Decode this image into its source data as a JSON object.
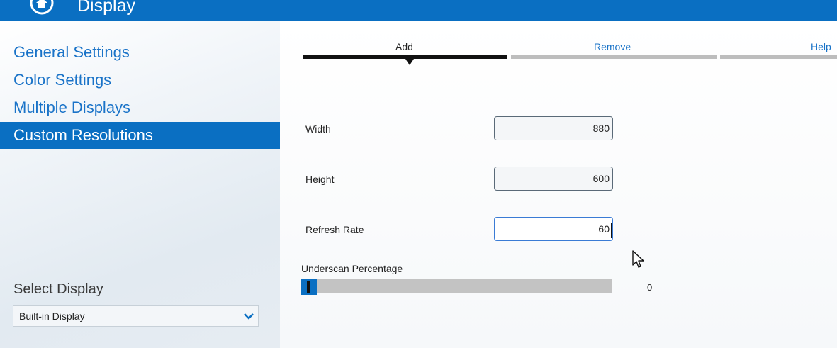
{
  "header": {
    "title": "Display",
    "icon": "home-icon"
  },
  "sidebar": {
    "items": [
      {
        "label": "General Settings",
        "selected": false
      },
      {
        "label": "Color Settings",
        "selected": false
      },
      {
        "label": "Multiple Displays",
        "selected": false
      },
      {
        "label": "Custom Resolutions",
        "selected": true
      }
    ],
    "select_display": {
      "label": "Select Display",
      "value": "Built-in Display",
      "icon": "chevron-down-icon"
    }
  },
  "tabs": [
    {
      "label": "Add",
      "active": true
    },
    {
      "label": "Remove",
      "active": false
    },
    {
      "label": "Help",
      "active": false
    }
  ],
  "form": {
    "width": {
      "label": "Width",
      "value": "880"
    },
    "height": {
      "label": "Height",
      "value": "600"
    },
    "refresh_rate": {
      "label": "Refresh Rate",
      "value": "60"
    }
  },
  "underscan": {
    "label": "Underscan Percentage",
    "value": "0",
    "level": 0
  },
  "colors": {
    "accent": "#0a6fc2",
    "link": "#1a73c8",
    "track": "#c3c3c3"
  }
}
